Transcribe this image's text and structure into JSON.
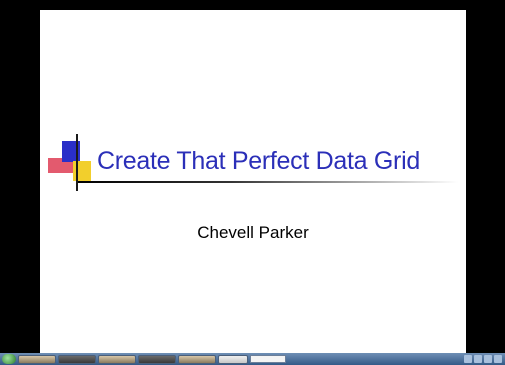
{
  "slide": {
    "title": "Create That Perfect Data Grid",
    "presenter": "Chevell Parker"
  },
  "colors": {
    "title": "#2b2fb8",
    "accent_blue": "#2a2fc8",
    "accent_red": "#e35a6e",
    "accent_yellow": "#f2cf2c",
    "letterbox": "#000000",
    "taskbar": "#345a87"
  },
  "taskbar": {
    "icons": [
      "start-orb-icon",
      "taskbar-window-icon",
      "search-box",
      "tray-icons"
    ]
  }
}
